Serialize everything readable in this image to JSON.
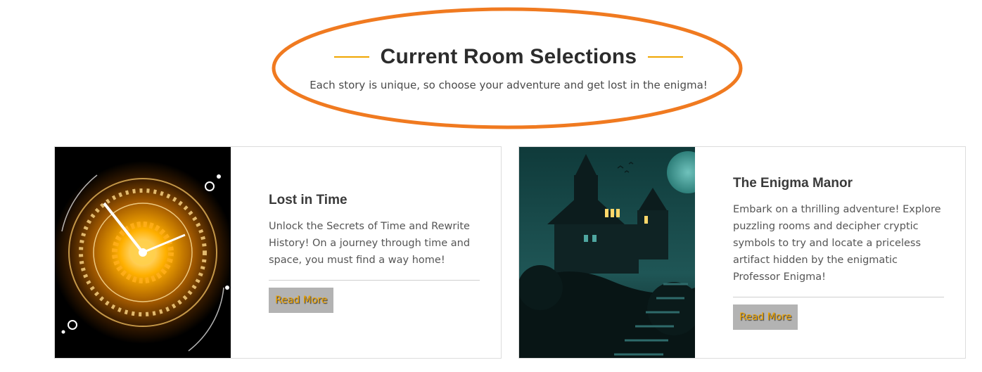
{
  "section": {
    "title": "Current Room Selections",
    "subtitle": "Each story is unique, so choose your adventure and get lost in the enigma!"
  },
  "colors": {
    "accent_gold": "#f0a500",
    "annotation_orange": "#f07a20",
    "button_bg": "#b3b3b3"
  },
  "rooms": [
    {
      "title": "Lost in Time",
      "description": "Unlock the Secrets of Time and Rewrite History! On a journey through time and space, you must find a way home!",
      "button_label": "Read More",
      "image_icon": "clock-icon"
    },
    {
      "title": "The Enigma Manor",
      "description": "Embark on a thrilling adventure! Explore puzzling rooms and decipher cryptic symbols to try and locate a priceless artifact hidden by the enigmatic Professor Enigma!",
      "button_label": "Read More",
      "image_icon": "haunted-house-icon"
    }
  ]
}
